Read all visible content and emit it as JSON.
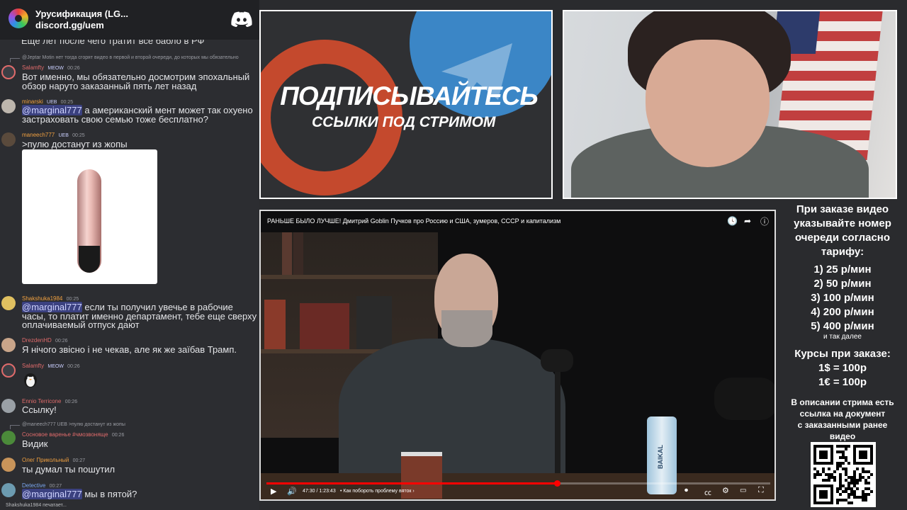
{
  "discord_banner": {
    "title": "Урусификация (LG...",
    "link": "discord.gg/uem"
  },
  "chat": {
    "cutoff_line": "Ещё лет после чего тратит все бабло в РФ",
    "messages": [
      {
        "reply": "@Jeptar Motin нет тогда сгорят видео в первой и второй очереди, до которых мы обязательно",
        "author": "Salamfty",
        "author_color": "#e06b6b",
        "badge": "MEOW",
        "time": "00:26",
        "lines": [
          "Вот именно, мы обязательно досмотрим эпохальный",
          "обзор наруто заказанный пять лет назад"
        ]
      },
      {
        "author": "minarski",
        "author_color": "#f0a040",
        "badge": "UEB",
        "time": "00:25",
        "mention": "@marginal777",
        "lines": [
          " а американский мент может так охуено",
          "застраховать свою семью тоже бесплатно?"
        ]
      },
      {
        "author": "maneech777",
        "author_color": "#f0a040",
        "badge": "UEB",
        "time": "00:25",
        "lines": [
          ">пулю достанут из жопы"
        ]
      },
      {
        "author": "Shakshuka1984",
        "author_color": "#f0a040",
        "time": "00:25",
        "mention": "@marginal777",
        "lines": [
          " если ты получил увечье в рабочие",
          "часы, то платит именно департамент, тебе еще сверху",
          "оплачиваемый отпуск дают"
        ]
      },
      {
        "author": "DrezdenHD",
        "author_color": "#e06b6b",
        "time": "00:26",
        "lines": [
          "Я нічого звісно і не чекав, але як же заїбав Трамп."
        ]
      },
      {
        "author": "Salamfty",
        "author_color": "#e06b6b",
        "badge": "MEOW",
        "time": "00:26",
        "lines": []
      },
      {
        "author": "Ennio Terricone",
        "author_color": "#e06b6b",
        "time": "00:26",
        "lines": [
          "Ссылку!"
        ]
      },
      {
        "reply": "@maneech777 UEB >пулю достанут из жопы",
        "author": "Сосновое варенье #чмозвоняще",
        "author_color": "#e06b6b",
        "time": "00:26",
        "lines": [
          "Видик"
        ]
      },
      {
        "author": "Олег Прикольный",
        "author_color": "#f0a040",
        "time": "00:27",
        "lines": [
          "ты думал ты пошутил"
        ]
      },
      {
        "author": "Detective",
        "author_color": "#7aa7f0",
        "time": "00:27",
        "mention": "@marginal777",
        "lines": [
          " мы в пятой?"
        ]
      }
    ],
    "typing": "Shakshuka1984 печатает..."
  },
  "promo": {
    "title": "ПОДПИСЫВАЙТЕСЬ",
    "subtitle": "ССЫЛКИ ПОД СТРИМОМ"
  },
  "player": {
    "title": "РАНЬШЕ БЫЛО ЛУЧШЕ! Дмитрий Goblin Пучков про Россию и США, зумеров, СССР и капитализм",
    "time": "47:30 / 1:23:43",
    "chapter": "• Как побороть проблему вяток  ›",
    "progress": 0.577,
    "bottle_label": "BAIKAL"
  },
  "info": {
    "heading": [
      "При заказе видео",
      "указывайте номер",
      "очереди согласно",
      "тарифу:"
    ],
    "prices": [
      "1) 25 р/мин",
      "2) 50 р/мин",
      "3) 100 р/мин",
      "4) 200 р/мин",
      "5) 400 р/мин"
    ],
    "etc": "и так далее",
    "rates_heading": "Курсы при заказе:",
    "rates": [
      "1$ = 100р",
      "1€ = 100р"
    ],
    "description": [
      "В описании стрима есть",
      "ссылка на документ",
      "с заказанными ранее",
      "видео"
    ]
  },
  "colors": {
    "discord_blurple": "#5865f2",
    "youtube_red": "#ff0000",
    "promo_blue": "#3b86c6",
    "promo_red": "#c4492d"
  }
}
